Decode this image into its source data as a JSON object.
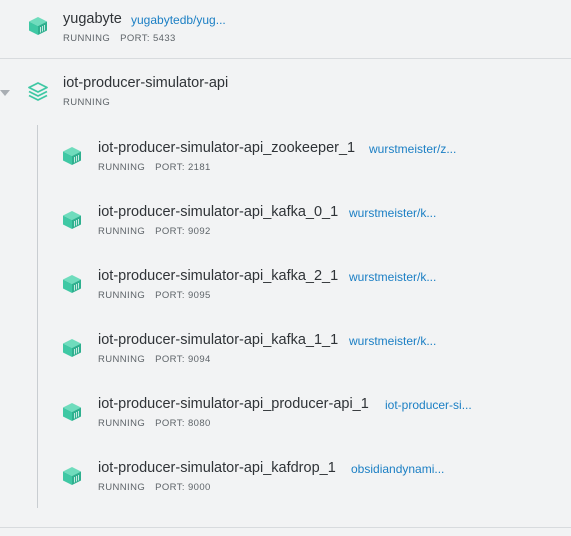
{
  "top_container": {
    "name": "yugabyte",
    "image": "yugabytedb/yug...",
    "status": "RUNNING",
    "port": "PORT: 5433",
    "icon": "container-icon"
  },
  "app_group": {
    "name": "iot-producer-simulator-api",
    "status": "RUNNING",
    "icon": "stack-icon",
    "expanded": true
  },
  "containers": [
    {
      "name": "iot-producer-simulator-api_zookeeper_1",
      "image": "wurstmeister/z...",
      "status": "RUNNING",
      "port": "PORT: 2181"
    },
    {
      "name": "iot-producer-simulator-api_kafka_0_1",
      "image": "wurstmeister/k...",
      "status": "RUNNING",
      "port": "PORT: 9092"
    },
    {
      "name": "iot-producer-simulator-api_kafka_2_1",
      "image": "wurstmeister/k...",
      "status": "RUNNING",
      "port": "PORT: 9095"
    },
    {
      "name": "iot-producer-simulator-api_kafka_1_1",
      "image": "wurstmeister/k...",
      "status": "RUNNING",
      "port": "PORT: 9094"
    },
    {
      "name": "iot-producer-simulator-api_producer-api_1",
      "image": "iot-producer-si...",
      "status": "RUNNING",
      "port": "PORT: 8080"
    },
    {
      "name": "iot-producer-simulator-api_kafdrop_1",
      "image": "obsidiandynami...",
      "status": "RUNNING",
      "port": "PORT: 9000"
    }
  ],
  "colors": {
    "accent": "#3fc8a4",
    "link": "#1b7fc4",
    "background": "#f2f3f4"
  }
}
